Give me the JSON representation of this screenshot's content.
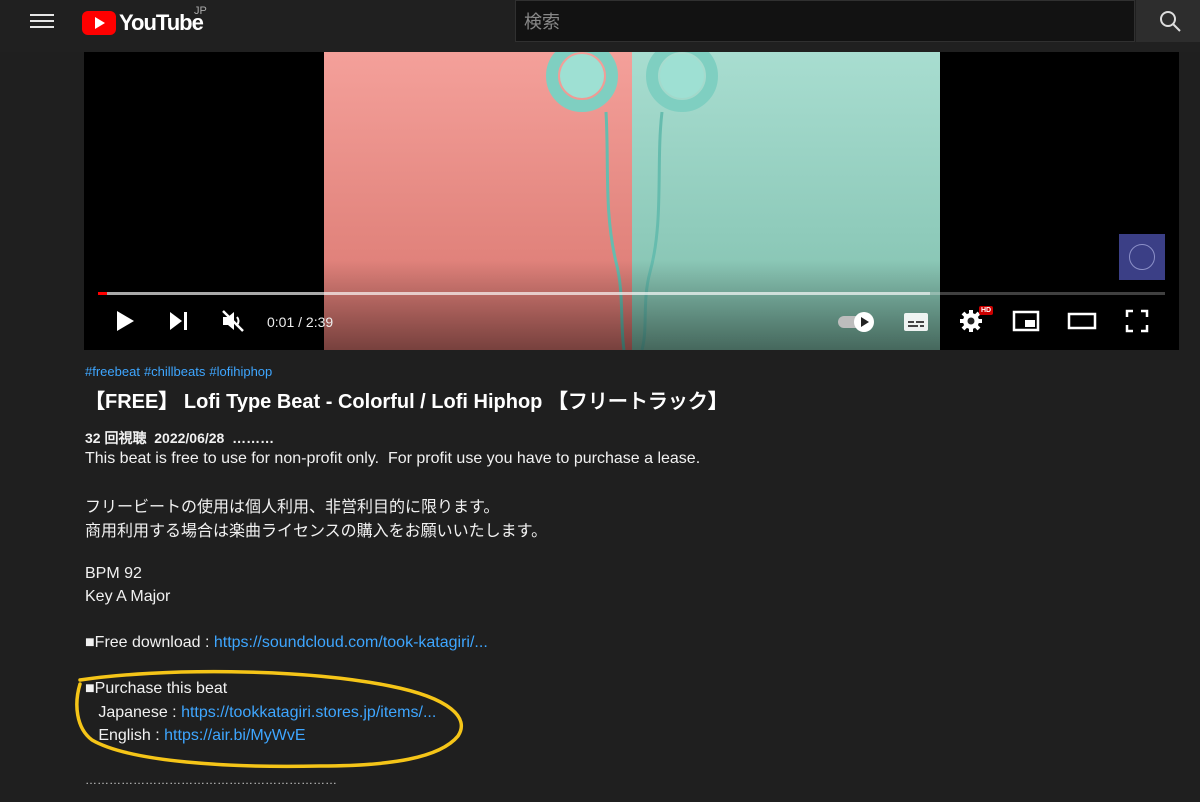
{
  "header": {
    "logo_text": "YouTube",
    "region": "JP",
    "search_placeholder": "検索"
  },
  "player": {
    "time": "0:01 / 2:39",
    "hd_badge": "HD",
    "progress_played": 0.008,
    "progress_loaded": 0.78
  },
  "video": {
    "hashtags": [
      "#freebeat",
      "#chillbeats",
      "#lofihiphop"
    ],
    "title": "【FREE】 Lofi Type Beat - Colorful / Lofi Hiphop 【フリートラック】",
    "views": "32 回視聴",
    "date": "2022/06/28",
    "more": "………"
  },
  "description": {
    "line1": "This beat is free to use for non-profit only.  For profit use you have to purchase a lease.",
    "line2": "フリービートの使用は個人利用、非営利目的に限ります。",
    "line3": "商用利用する場合は楽曲ライセンスの購入をお願いいたします。",
    "bpm": "BPM 92",
    "key": "Key A Major",
    "free_label": "■Free download : ",
    "free_link": "https://soundcloud.com/took-katagiri/...",
    "purchase_label": "■Purchase this beat",
    "jp_label": "   Japanese : ",
    "jp_link": "https://tookkatagiri.stores.jp/items/...",
    "en_label": "   English : ",
    "en_link": "https://air.bi/MyWvE",
    "divider": "………………………………………………………"
  },
  "colors": {
    "background": "#1f1f1f",
    "link": "#3ea6ff",
    "brand_red": "#ff0000",
    "annotation": "#f5c518"
  }
}
